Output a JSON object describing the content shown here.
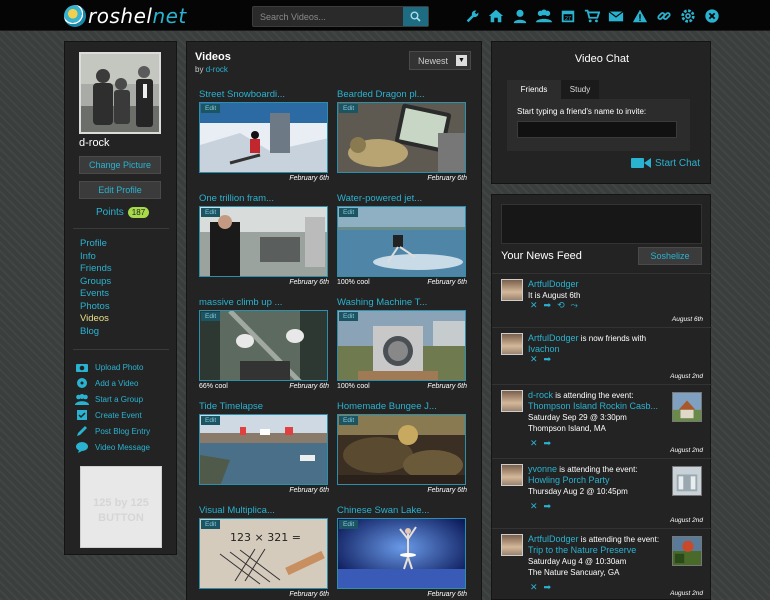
{
  "brand": {
    "logo_prefix": "ro",
    "logo_first": "s",
    "logo_rest": "hel",
    "logo_accent": "net"
  },
  "search": {
    "placeholder": "Search Videos..."
  },
  "top_icons": [
    "wrench-icon",
    "home-icon",
    "user-icon",
    "group-icon",
    "calendar-icon",
    "cart-icon",
    "mail-icon",
    "alert-icon",
    "link-icon",
    "gear-icon",
    "close-icon"
  ],
  "profile": {
    "username": "d-rock",
    "change_picture": "Change Picture",
    "edit_profile": "Edit Profile",
    "points_label": "Points",
    "points_value": "187"
  },
  "nav": [
    "Profile",
    "Info",
    "Friends",
    "Groups",
    "Events",
    "Photos",
    "Videos",
    "Blog"
  ],
  "nav_active": "Videos",
  "actions": [
    {
      "label": "Upload Photo",
      "icon": "camera-icon"
    },
    {
      "label": "Add a Video",
      "icon": "film-icon"
    },
    {
      "label": "Start a Group",
      "icon": "group-icon"
    },
    {
      "label": "Create Event",
      "icon": "checkbox-icon"
    },
    {
      "label": "Post Blog Entry",
      "icon": "pencil-icon"
    },
    {
      "label": "Video Message",
      "icon": "speech-bubble-icon"
    }
  ],
  "ad": {
    "line1": "125 by 125",
    "line2": "BUTTON"
  },
  "videos_panel": {
    "title": "Videos",
    "by_prefix": "by",
    "by_user": "d-rock",
    "sort_value": "Newest"
  },
  "videos": [
    {
      "title": "Street Snowboardi...",
      "edit": "Edit",
      "stat": "",
      "date": "February 6th",
      "scene": "snow"
    },
    {
      "title": "Bearded Dragon pl...",
      "edit": "Edit",
      "stat": "",
      "date": "February 6th",
      "scene": "dragon"
    },
    {
      "title": "One trillion fram...",
      "edit": "Edit",
      "stat": "",
      "date": "February 6th",
      "scene": "lab"
    },
    {
      "title": "Water-powered jet...",
      "edit": "Edit",
      "stat": "100% cool",
      "date": "February 6th",
      "scene": "water"
    },
    {
      "title": "massive climb up ...",
      "edit": "Edit",
      "stat": "66% cool",
      "date": "February 6th",
      "scene": "climb"
    },
    {
      "title": "Washing Machine T...",
      "edit": "Edit",
      "stat": "100% cool",
      "date": "February 6th",
      "scene": "washer"
    },
    {
      "title": "Tide Timelapse",
      "edit": "Edit",
      "stat": "",
      "date": "February 6th",
      "scene": "harbor"
    },
    {
      "title": "Homemade Bungee J...",
      "edit": "Edit",
      "stat": "",
      "date": "February 6th",
      "scene": "rocks"
    },
    {
      "title": "Visual Multiplica...",
      "edit": "Edit",
      "stat": "",
      "date": "February 6th",
      "scene": "paper"
    },
    {
      "title": "Chinese Swan Lake...",
      "edit": "Edit",
      "stat": "",
      "date": "February 6th",
      "scene": "stage"
    }
  ],
  "video_chat": {
    "title": "Video Chat",
    "tab_friends": "Friends",
    "tab_study": "Study",
    "invite_label": "Start typing a friend's name to invite:",
    "start_chat": "Start Chat"
  },
  "news_feed": {
    "title": "Your News Feed",
    "button": "Soshelize",
    "items": [
      {
        "user": "ArtfulDodger",
        "text": "It is August 6th",
        "link": "",
        "extra1": "",
        "extra2": "",
        "date": "August 6th",
        "icons": [
          "close-icon",
          "arrow-icon",
          "refresh-icon",
          "share-icon"
        ],
        "pic": ""
      },
      {
        "user": "ArtfulDodger",
        "text": "is now friends with",
        "link": "Ivachon",
        "extra1": "",
        "extra2": "",
        "date": "August 2nd",
        "icons": [
          "close-icon",
          "arrow-icon"
        ],
        "pic": ""
      },
      {
        "user": "d-rock",
        "text": "is attending the event:",
        "link": "Thompson Island Rockin Casb...",
        "extra1": "Saturday Sep 29 @ 3:30pm",
        "extra2": "Thompson Island, MA",
        "date": "August 2nd",
        "icons": [
          "close-icon",
          "arrow-icon"
        ],
        "pic": "house"
      },
      {
        "user": "yvonne",
        "text": "is attending the event:",
        "link": "Howling Porch Party",
        "extra1": "Thursday Aug 2 @ 10:45pm",
        "extra2": "",
        "date": "August 2nd",
        "icons": [
          "close-icon",
          "arrow-icon"
        ],
        "pic": "porch"
      },
      {
        "user": "ArtfulDodger",
        "text": "is attending the event:",
        "link": "Trip to the Nature Preserve",
        "extra1": "Saturday Aug 4 @ 10:30am",
        "extra2": "The Nature Sancuary, GA",
        "date": "August 2nd",
        "icons": [
          "close-icon",
          "arrow-icon"
        ],
        "pic": "nature"
      }
    ]
  }
}
